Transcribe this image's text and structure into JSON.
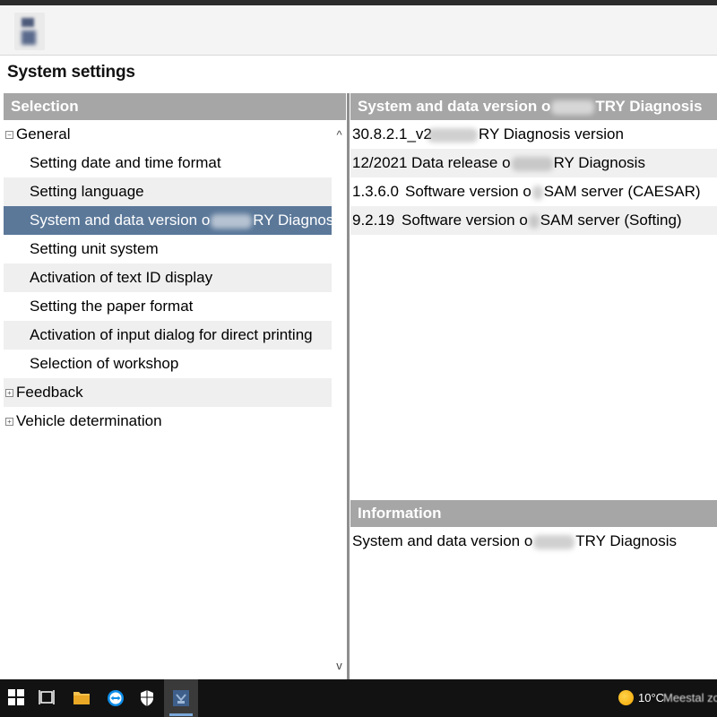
{
  "app": {
    "title": "System settings"
  },
  "selection_panel": {
    "header": "Selection",
    "items": [
      {
        "label": "General",
        "level": 0,
        "expander": "⊟"
      },
      {
        "label": "Setting date and time format",
        "level": 1
      },
      {
        "label": "Setting language",
        "level": 1
      },
      {
        "label": "System and data version o",
        "label_tail": "RY Diagnosis",
        "level": 1,
        "selected": true
      },
      {
        "label": "Setting unit system",
        "level": 1
      },
      {
        "label": "Activation of text ID display",
        "level": 1
      },
      {
        "label": "Setting the paper format",
        "level": 1
      },
      {
        "label": "Activation of input dialog for direct printing",
        "level": 1
      },
      {
        "label": "Selection of workshop",
        "level": 1
      },
      {
        "label": "Feedback",
        "level": 0,
        "expander": "⊞"
      },
      {
        "label": "Vehicle determination",
        "level": 0,
        "expander": "⊞"
      }
    ],
    "scroll_up": "^",
    "scroll_down": "v"
  },
  "version_panel": {
    "header_a": "System and data version o",
    "header_b": "TRY Diagnosis",
    "rows": [
      {
        "value": "30.8.2.1_v2",
        "desc_a": "",
        "desc_b": "RY Diagnosis version"
      },
      {
        "value": "12/2021",
        "desc_a": "Data release o",
        "desc_b": "RY Diagnosis"
      },
      {
        "value": "1.3.6.0",
        "desc_a": "Software version o",
        "desc_b": "SAM server (CAESAR)"
      },
      {
        "value": "9.2.19",
        "desc_a": "Software version o",
        "desc_b": "SAM server (Softing)"
      }
    ]
  },
  "info_panel": {
    "header": "Information",
    "text_a": "System and data version o",
    "text_b": "TRY Diagnosis"
  },
  "taskbar": {
    "weather_temp": "10°C",
    "weather_desc": "Meestal zonn"
  },
  "colors": {
    "panel_header": "#a6a6a6",
    "selected_row": "#5b7899",
    "taskbar": "#121212"
  }
}
